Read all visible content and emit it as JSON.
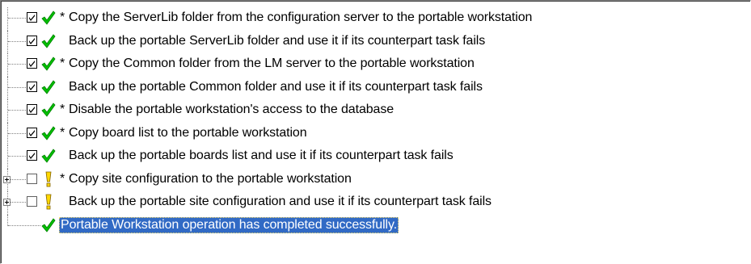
{
  "tree": {
    "items": [
      {
        "star": "*",
        "text": "Copy the ServerLib folder from the configuration server to the portable workstation",
        "checkbox": "checked",
        "status": "check-icon",
        "expandable": false
      },
      {
        "star": "",
        "text": "Back up the portable ServerLib folder and use it if its counterpart task fails",
        "checkbox": "checked",
        "status": "check-icon",
        "expandable": false
      },
      {
        "star": "*",
        "text": "Copy the Common folder from the LM server to the portable workstation",
        "checkbox": "checked",
        "status": "check-icon",
        "expandable": false
      },
      {
        "star": "",
        "text": "Back up the portable Common folder and use it if its counterpart task fails",
        "checkbox": "checked",
        "status": "check-icon",
        "expandable": false
      },
      {
        "star": "*",
        "text": "Disable the portable workstation's access to the database",
        "checkbox": "checked",
        "status": "check-icon",
        "expandable": false
      },
      {
        "star": "*",
        "text": "Copy board list to the portable workstation",
        "checkbox": "checked",
        "status": "check-icon",
        "expandable": false
      },
      {
        "star": "",
        "text": "Back up the portable boards list and use it if its counterpart task fails",
        "checkbox": "checked",
        "status": "check-icon",
        "expandable": false
      },
      {
        "star": "*",
        "text": "Copy site configuration to the portable workstation",
        "checkbox": "unchecked",
        "status": "warning-icon",
        "expandable": true
      },
      {
        "star": "",
        "text": "Back up the portable site configuration and use it if its counterpart task fails",
        "checkbox": "unchecked",
        "status": "warning-icon",
        "expandable": true
      }
    ],
    "final_item": {
      "text": "Portable Workstation operation has completed successfully.",
      "status": "check-icon",
      "selected": true
    }
  },
  "colors": {
    "check_green": "#00c000",
    "warning_yellow": "#ffd800",
    "selection_blue": "#316ac5"
  }
}
